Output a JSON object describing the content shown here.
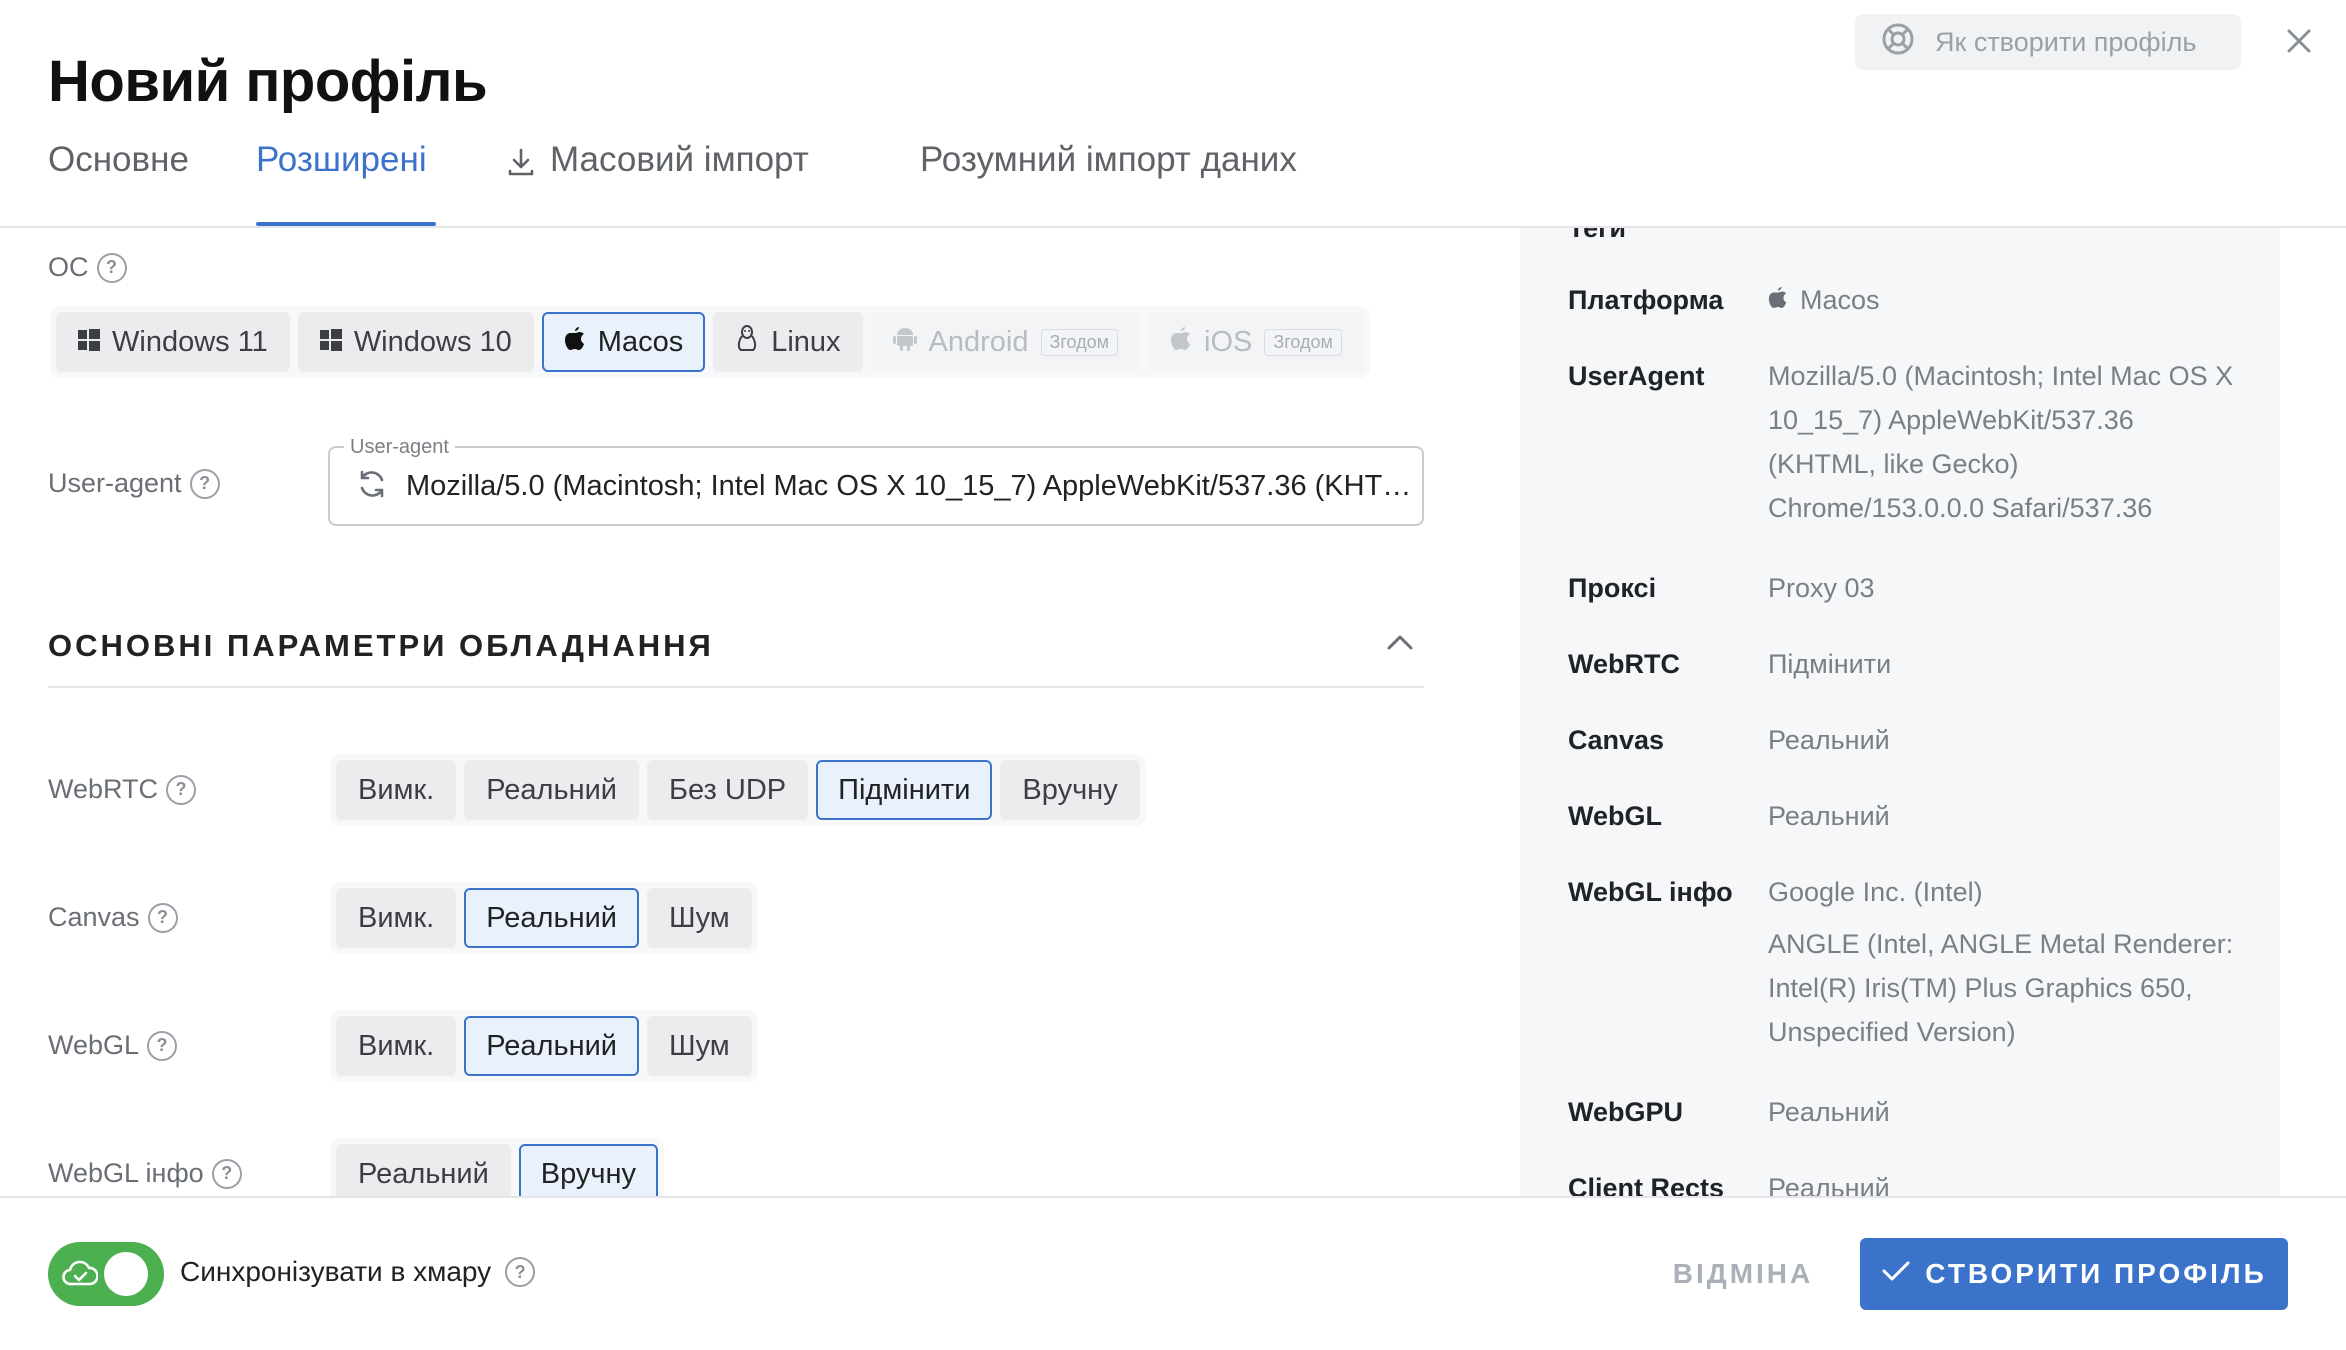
{
  "header": {
    "title": "Новий профіль",
    "help_label": "Як створити профіль"
  },
  "tabs": [
    {
      "label": "Основне",
      "active": false
    },
    {
      "label": "Розширені",
      "active": true
    },
    {
      "label": "Масовий імпорт",
      "active": false,
      "icon": "download-icon"
    },
    {
      "label": "Розумний імпорт даних",
      "active": false
    }
  ],
  "os": {
    "label": "ОС",
    "options": [
      {
        "label": "Windows 11",
        "icon": "windows-icon",
        "selected": false,
        "disabled": false
      },
      {
        "label": "Windows 10",
        "icon": "windows-icon",
        "selected": false,
        "disabled": false
      },
      {
        "label": "Macos",
        "icon": "apple-icon",
        "selected": true,
        "disabled": false
      },
      {
        "label": "Linux",
        "icon": "linux-icon",
        "selected": false,
        "disabled": false
      },
      {
        "label": "Android",
        "icon": "android-icon",
        "selected": false,
        "disabled": true,
        "badge": "Згодом"
      },
      {
        "label": "iOS",
        "icon": "apple-icon",
        "selected": false,
        "disabled": true,
        "badge": "Згодом"
      }
    ]
  },
  "user_agent": {
    "label": "User-agent",
    "legend": "User-agent",
    "value": "Mozilla/5.0 (Macintosh; Intel Mac OS X 10_15_7) AppleWebKit/537.36 (KHTML, like Gecko) Chrome/153.0.0.0 Safari/537.36"
  },
  "hardware_section": {
    "title": "ОСНОВНІ ПАРАМЕТРИ ОБЛАДНАННЯ",
    "webrtc": {
      "label": "WebRTC",
      "options": [
        "Вимк.",
        "Реальний",
        "Без UDP",
        "Підмінити",
        "Вручну"
      ],
      "selected": 3
    },
    "canvas": {
      "label": "Canvas",
      "options": [
        "Вимк.",
        "Реальний",
        "Шум"
      ],
      "selected": 1
    },
    "webgl": {
      "label": "WebGL",
      "options": [
        "Вимк.",
        "Реальний",
        "Шум"
      ],
      "selected": 1
    },
    "webgl_info": {
      "label": "WebGL інфо",
      "options": [
        "Реальний",
        "Вручну"
      ],
      "selected": 1
    }
  },
  "summary": {
    "partial_top": "Теги",
    "rows": [
      {
        "key": "Платформа",
        "value": "Macos"
      },
      {
        "key": "UserAgent",
        "value": "Mozilla/5.0 (Macintosh; Intel Mac OS X 10_15_7) AppleWebKit/537.36 (KHTML, like Gecko) Chrome/153.0.0.0 Safari/537.36"
      },
      {
        "key": "Проксі",
        "value": "Proxy 03"
      },
      {
        "key": "WebRTC",
        "value": "Підмінити"
      },
      {
        "key": "Canvas",
        "value": "Реальний"
      },
      {
        "key": "WebGL",
        "value": "Реальний"
      },
      {
        "key": "WebGL інфо",
        "value": "Google Inc. (Intel)",
        "value2": "ANGLE (Intel, ANGLE Metal Renderer: Intel(R) Iris(TM) Plus Graphics 650, Unspecified Version)"
      },
      {
        "key": "WebGPU",
        "value": "Реальний"
      },
      {
        "key": "Client Rects",
        "value": "Реальний"
      }
    ]
  },
  "footer": {
    "sync_label": "Синхронізувати в хмару",
    "sync_enabled": true,
    "cancel_label": "ВІДМІНА",
    "create_label": "СТВОРИТИ ПРОФІЛЬ"
  },
  "colors": {
    "accent": "#3a73c9",
    "toggle_on": "#4caf50"
  }
}
